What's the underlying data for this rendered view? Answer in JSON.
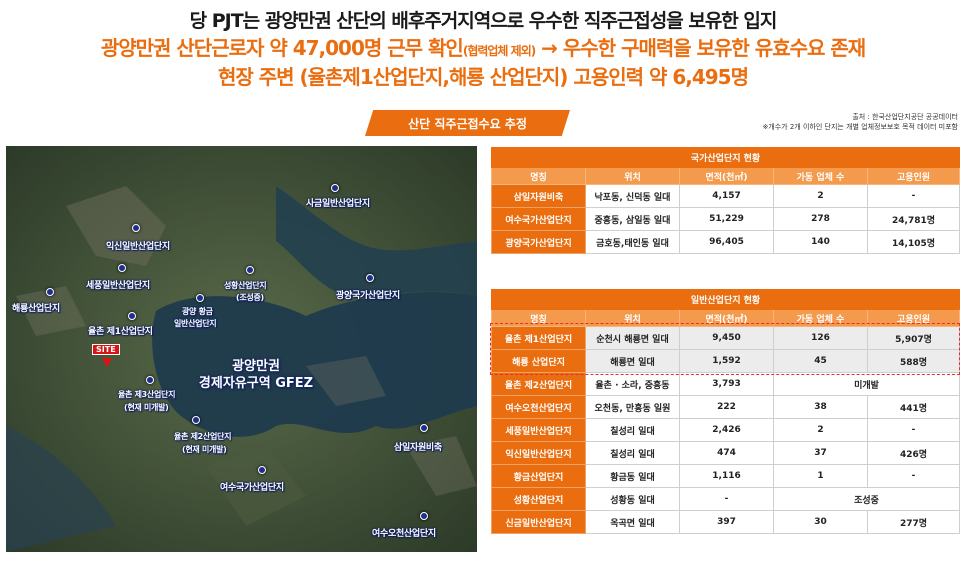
{
  "header": {
    "line1": "당 PJT는 광양만권 산단의 배후주거지역으로 우수한 직주근접성을 보유한 입지",
    "line2_main": "광양만권 산단근로자 약 47,000명 근무 확인",
    "line2_note": "(협력업체 제외)",
    "line2_tail": " → 우수한 구매력을 보유한 유효수요 존재",
    "line3": "현장 주변 (율촌제1산업단지,해룡 산업단지) 고용인력 약 6,495명"
  },
  "section": {
    "title": "산단 직주근접수요 추정",
    "source_line1": "출처 : 한국산업단지공단 공공데이터",
    "source_line2": "※개수가 2개 이하인 단지는 개별 업체정보보호 목적 데이터 미포함"
  },
  "map": {
    "site_label": "SITE",
    "fez_line1": "광양만권",
    "fez_line2": "경제자유구역 GFEZ",
    "labels": [
      {
        "id": "sageum",
        "text": "사금일반산업단지"
      },
      {
        "id": "ikshin",
        "text": "익신일반산업단지"
      },
      {
        "id": "sepung",
        "text": "세풍일반산업단지"
      },
      {
        "id": "haeryong",
        "text": "해룡산업단지"
      },
      {
        "id": "hwanggeum1",
        "text": "광양 황금"
      },
      {
        "id": "hwanggeum2",
        "text": "일반산업단지"
      },
      {
        "id": "yulchon1",
        "text": "율촌 제1산업단지"
      },
      {
        "id": "seonghwang1",
        "text": "성황산업단지"
      },
      {
        "id": "seonghwang2",
        "text": "(조성중)"
      },
      {
        "id": "gwangyang",
        "text": "광양국가산업단지"
      },
      {
        "id": "yulchon3a",
        "text": "율촌 제3산업단지"
      },
      {
        "id": "yulchon3b",
        "text": "(현재 미개발)"
      },
      {
        "id": "yulchon2a",
        "text": "율촌 제2산업단지"
      },
      {
        "id": "yulchon2b",
        "text": "(현재 미개발)"
      },
      {
        "id": "samil",
        "text": "삼일자원비축"
      },
      {
        "id": "yeosu",
        "text": "여수국가산업단지"
      },
      {
        "id": "yeosuocheon",
        "text": "여수오천산업단지"
      }
    ]
  },
  "national": {
    "caption": "국가산업단지 현황",
    "headers": [
      "명칭",
      "위치",
      "면적(천㎡)",
      "가동 업체 수",
      "고용인원"
    ],
    "rows": [
      [
        "삼일자원비축",
        "낙포동, 신덕동 일대",
        "4,157",
        "2",
        "-"
      ],
      [
        "여수국가산업단지",
        "중흥동, 삼일동 일대",
        "51,229",
        "278",
        "24,781명"
      ],
      [
        "광양국가산업단지",
        "금호동,태인동 일대",
        "96,405",
        "140",
        "14,105명"
      ]
    ]
  },
  "general": {
    "caption": "일반산업단지 현황",
    "headers": [
      "명칭",
      "위치",
      "면적(천㎡)",
      "가동 업체 수",
      "고용인원"
    ],
    "rows": [
      [
        "율촌 제1산업단지",
        "순천시 해룡면 일대",
        "9,450",
        "126",
        "5,907명"
      ],
      [
        "해룡 산업단지",
        "해룡면 일대",
        "1,592",
        "45",
        "588명"
      ],
      [
        "율촌 제2산업단지",
        "율촌 · 소라, 중흥동",
        "3,793",
        "미개발"
      ],
      [
        "여수오천산업단지",
        "오천동, 만흥동 일원",
        "222",
        "38",
        "441명"
      ],
      [
        "세풍일반산업단지",
        "칠성리 일대",
        "2,426",
        "2",
        "-"
      ],
      [
        "익신일반산업단지",
        "칠성리 일대",
        "474",
        "37",
        "426명"
      ],
      [
        "황금산업단지",
        "황금동 일대",
        "1,116",
        "1",
        "-"
      ],
      [
        "성황산업단지",
        "성황동 일대",
        "-",
        "조성중"
      ],
      [
        "신금일반산업단지",
        "옥곡면 일대",
        "397",
        "30",
        "277명"
      ]
    ]
  },
  "colors": {
    "accent": "#ea6e10",
    "header_light": "#f39a4d",
    "highlight_border": "#e53030",
    "site": "#d81414"
  }
}
